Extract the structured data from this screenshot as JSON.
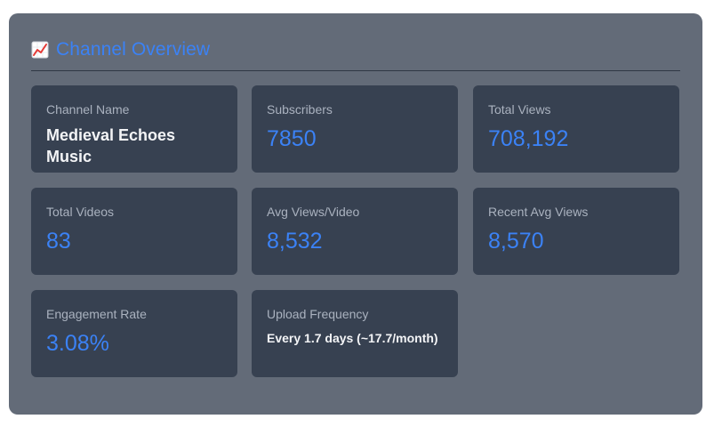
{
  "header": {
    "icon": "chart-increasing-icon",
    "title": "Channel Overview",
    "accent_color": "#3b82f6"
  },
  "cards": [
    {
      "label": "Channel Name",
      "value": "Medieval Echoes Music"
    },
    {
      "label": "Subscribers",
      "value": "7850"
    },
    {
      "label": "Total Views",
      "value": "708,192"
    },
    {
      "label": "Total Videos",
      "value": "83"
    },
    {
      "label": "Avg Views/Video",
      "value": "8,532"
    },
    {
      "label": "Recent Avg Views",
      "value": "8,570"
    },
    {
      "label": "Engagement Rate",
      "value": "3.08%"
    },
    {
      "label": "Upload Frequency",
      "value": "Every 1.7 days (~17.7/month)"
    }
  ]
}
